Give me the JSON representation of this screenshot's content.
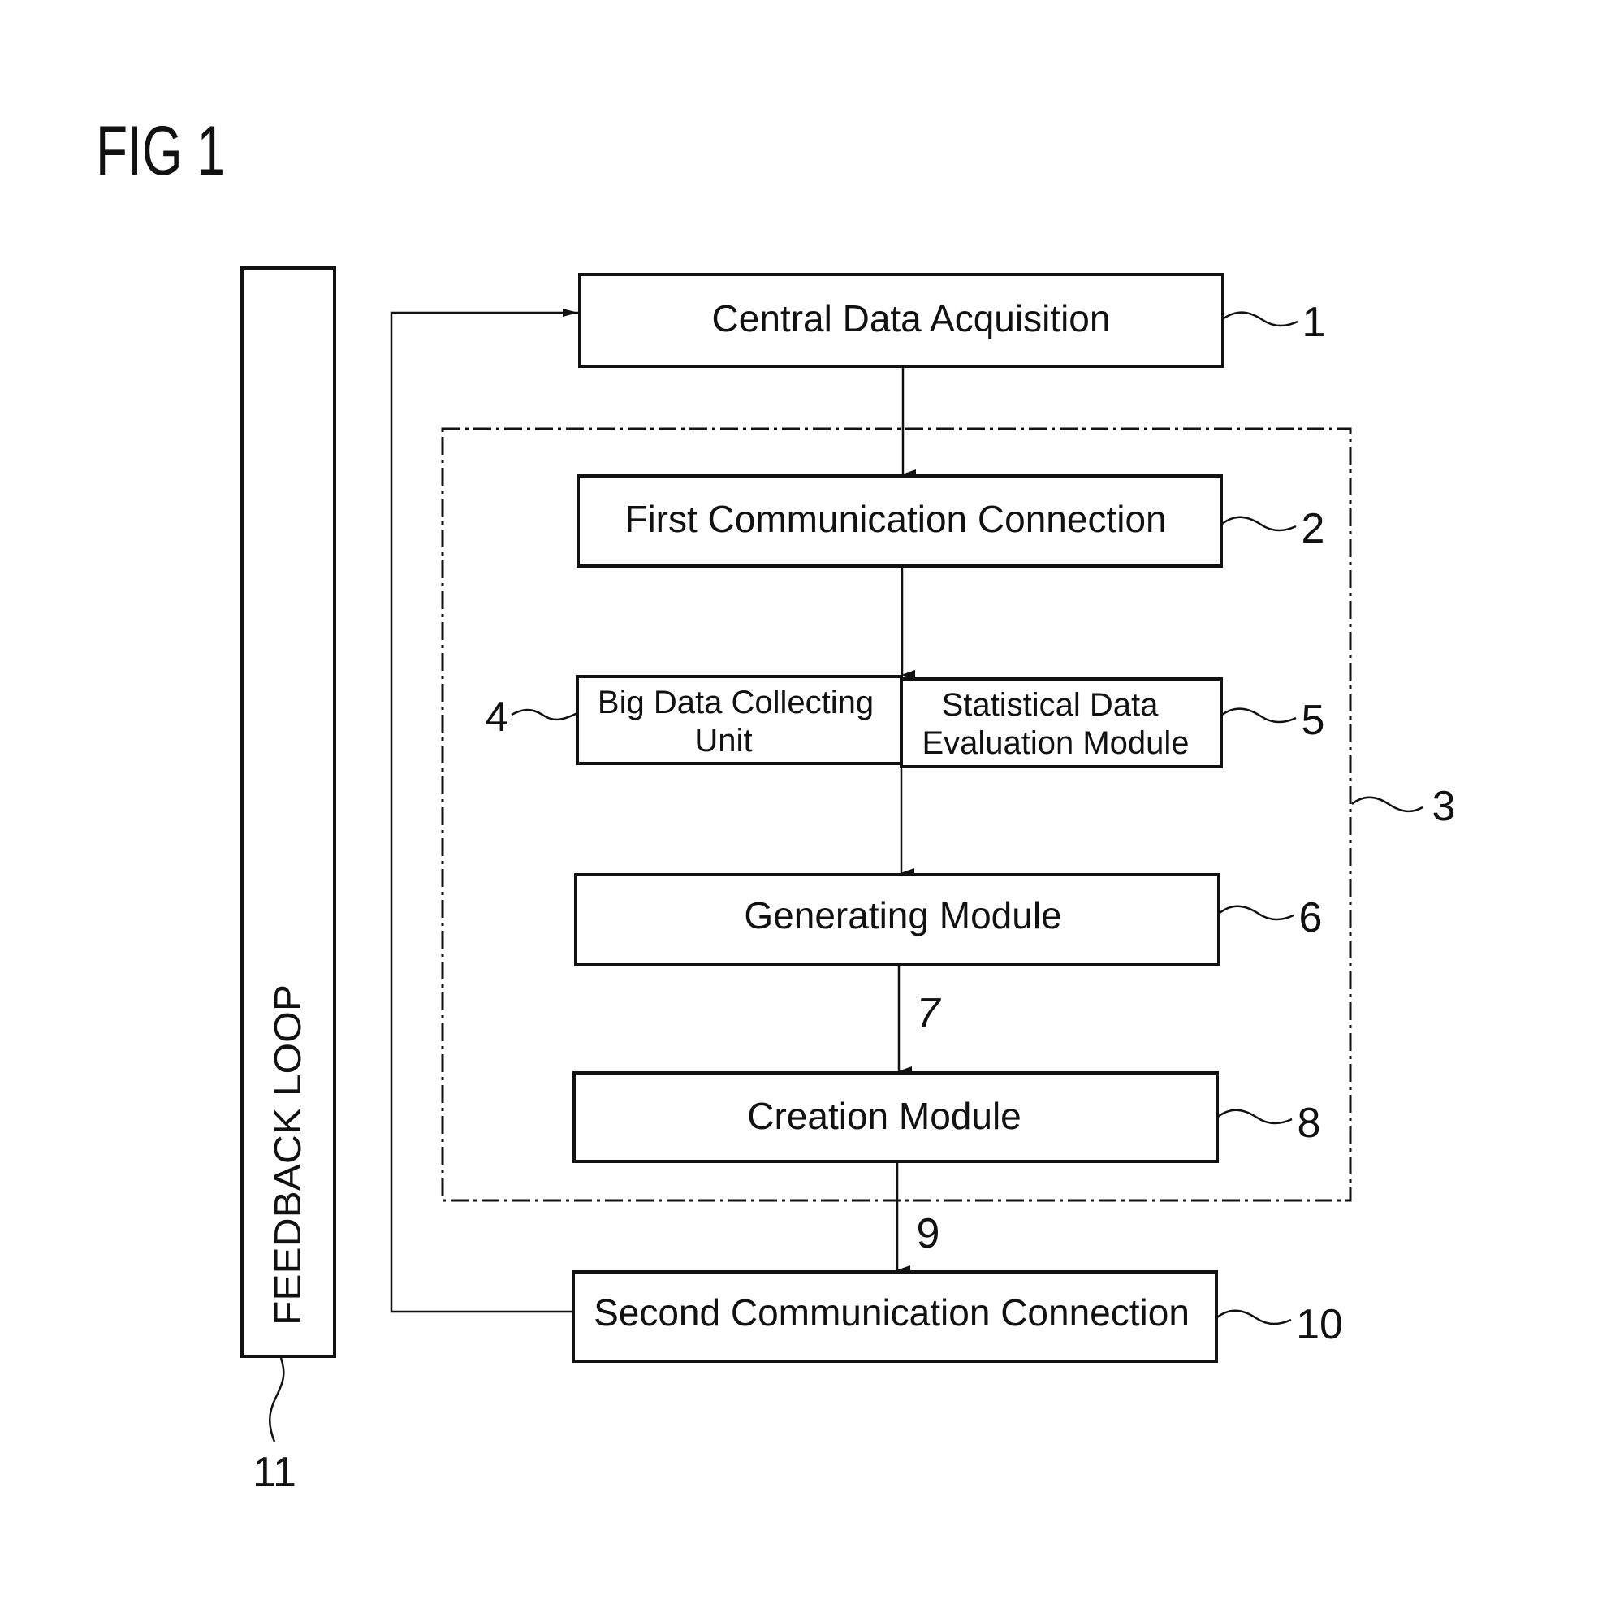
{
  "figure": {
    "title": "FIG 1"
  },
  "feedback_loop": {
    "label": "FEEDBACK LOOP",
    "ref": "11"
  },
  "group": {
    "ref": "3"
  },
  "boxes": {
    "central_data_acquisition": {
      "label": "Central Data Acquisition",
      "ref": "1"
    },
    "first_communication_connection": {
      "label": "First Communication Connection",
      "ref": "2"
    },
    "big_data_collecting_unit": {
      "label_line1": "Big Data Collecting",
      "label_line2": "Unit",
      "ref": "4"
    },
    "statistical_data_evaluation_module": {
      "label_line1": "Statistical Data",
      "label_line2": "Evaluation Module",
      "ref": "5"
    },
    "generating_module": {
      "label": "Generating Module",
      "ref": "6"
    },
    "creation_module": {
      "label": "Creation Module",
      "ref": "8"
    },
    "second_communication_connection": {
      "label": "Second Communication Connection",
      "ref": "10"
    }
  },
  "connections": {
    "generating_to_creation_ref": "7",
    "creation_to_second_ref": "9"
  },
  "colors": {
    "ink": "#111111",
    "background": "#ffffff"
  }
}
